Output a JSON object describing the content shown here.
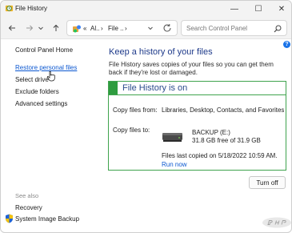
{
  "window": {
    "title": "File History",
    "icon": "file-history-app-icon",
    "controls": {
      "minimize": "—",
      "maximize": "☐",
      "close": "✕"
    }
  },
  "nav": {
    "back_icon": "arrow-left-icon",
    "forward_icon": "arrow-right-icon",
    "recent_icon": "chevron-down-icon",
    "up_icon": "arrow-up-icon",
    "address": {
      "icon": "control-panel-icon",
      "segments": [
        "«",
        "Al..",
        "›",
        "File ..",
        "›"
      ],
      "dropdown_icon": "chevron-down-icon",
      "refresh_icon": "refresh-icon"
    },
    "search": {
      "placeholder": "Search Control Panel",
      "icon": "search-icon"
    }
  },
  "help_icon": "help-icon",
  "sidebar": {
    "links": [
      {
        "label": "Control Panel Home",
        "state": "normal"
      },
      {
        "label": "Restore personal files",
        "state": "hover"
      },
      {
        "label": "Select drive",
        "state": "normal"
      },
      {
        "label": "Exclude folders",
        "state": "normal"
      },
      {
        "label": "Advanced settings",
        "state": "normal"
      }
    ],
    "see_also_label": "See also",
    "see_also": [
      {
        "label": "Recovery"
      },
      {
        "label": "System Image Backup",
        "icon": "shield-icon"
      }
    ]
  },
  "main": {
    "title": "Keep a history of your files",
    "description": "File History saves copies of your files so you can get them back if they're lost or damaged.",
    "status_title": "File History is on",
    "status_color": "#2e9c3f",
    "copy_from_label": "Copy files from:",
    "copy_from_value": "Libraries, Desktop, Contacts, and Favorites",
    "copy_to_label": "Copy files to:",
    "drive_name": "BACKUP (E:)",
    "drive_free": "31.8 GB free of 31.9 GB",
    "last_copied": "Files last copied on 5/18/2022 10:59 AM.",
    "run_now": "Run now",
    "turn_off": "Turn off"
  },
  "watermark": "php-logo"
}
